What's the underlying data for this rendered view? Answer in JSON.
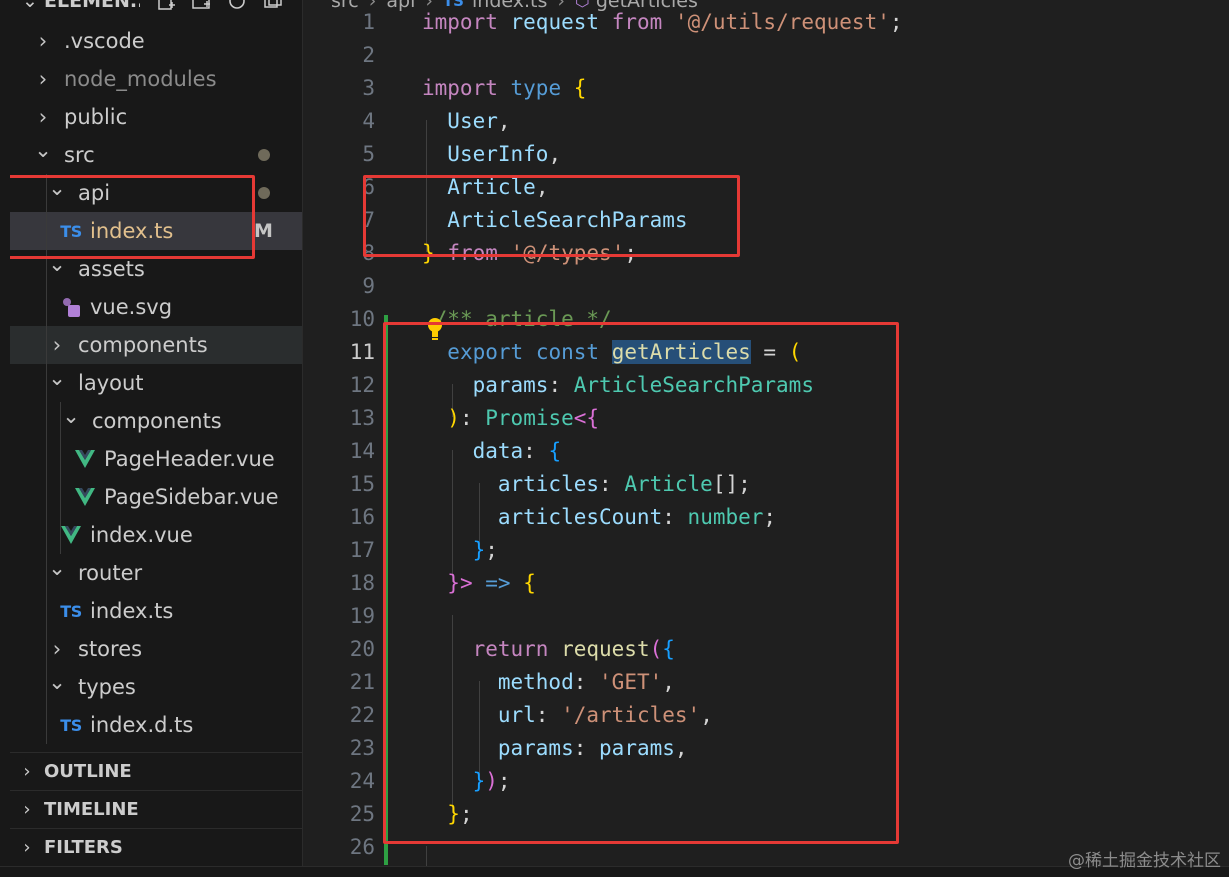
{
  "explorer": {
    "title": "ELEMEN...",
    "actions": [
      "new-file-icon",
      "new-folder-icon",
      "refresh-icon",
      "collapse-all-icon"
    ]
  },
  "tree": [
    {
      "label": ".vscode",
      "kind": "folder",
      "expanded": false,
      "depth": 0
    },
    {
      "label": "node_modules",
      "kind": "folder",
      "expanded": false,
      "depth": 0,
      "dim": true
    },
    {
      "label": "public",
      "kind": "folder",
      "expanded": false,
      "depth": 0
    },
    {
      "label": "src",
      "kind": "folder",
      "expanded": true,
      "depth": 0,
      "dot": true
    },
    {
      "label": "api",
      "kind": "folder",
      "expanded": true,
      "depth": 1,
      "dot": true
    },
    {
      "label": "index.ts",
      "kind": "ts",
      "depth": 2,
      "git": "M",
      "selected": true
    },
    {
      "label": "assets",
      "kind": "folder",
      "expanded": true,
      "depth": 1
    },
    {
      "label": "vue.svg",
      "kind": "svg",
      "depth": 2
    },
    {
      "label": "components",
      "kind": "folder",
      "expanded": false,
      "depth": 1,
      "hovered": true
    },
    {
      "label": "layout",
      "kind": "folder",
      "expanded": true,
      "depth": 1
    },
    {
      "label": "components",
      "kind": "folder",
      "expanded": true,
      "depth": 2
    },
    {
      "label": "PageHeader.vue",
      "kind": "vue",
      "depth": 3
    },
    {
      "label": "PageSidebar.vue",
      "kind": "vue",
      "depth": 3
    },
    {
      "label": "index.vue",
      "kind": "vue",
      "depth": 2
    },
    {
      "label": "router",
      "kind": "folder",
      "expanded": true,
      "depth": 1
    },
    {
      "label": "index.ts",
      "kind": "ts",
      "depth": 2
    },
    {
      "label": "stores",
      "kind": "folder",
      "expanded": false,
      "depth": 1
    },
    {
      "label": "types",
      "kind": "folder",
      "expanded": true,
      "depth": 1
    },
    {
      "label": "index.d.ts",
      "kind": "ts",
      "depth": 2
    }
  ],
  "git_badge": "M",
  "ts_badge": "TS",
  "sections": [
    "OUTLINE",
    "TIMELINE",
    "FILTERS"
  ],
  "breadcrumb": [
    "src",
    "api",
    "index.ts",
    "getArticles"
  ],
  "active_line": 11,
  "code_lines": [
    {
      "n": "1",
      "tokens": [
        [
          "kw",
          "import"
        ],
        [
          "",
          " "
        ],
        [
          "prop",
          "request"
        ],
        [
          "",
          " "
        ],
        [
          "kw",
          "from"
        ],
        [
          "",
          " "
        ],
        [
          "str",
          "'@/utils/request'"
        ],
        [
          "punc",
          ";"
        ]
      ]
    },
    {
      "n": "2",
      "tokens": []
    },
    {
      "n": "3",
      "tokens": [
        [
          "kw",
          "import"
        ],
        [
          "",
          " "
        ],
        [
          "kw2",
          "type"
        ],
        [
          "",
          " "
        ],
        [
          "b1",
          "{"
        ]
      ]
    },
    {
      "n": "4",
      "tokens": [
        [
          "",
          "  "
        ],
        [
          "prop",
          "User"
        ],
        [
          "punc",
          ","
        ]
      ]
    },
    {
      "n": "5",
      "tokens": [
        [
          "",
          "  "
        ],
        [
          "prop",
          "UserInfo"
        ],
        [
          "punc",
          ","
        ]
      ]
    },
    {
      "n": "6",
      "tokens": [
        [
          "",
          "  "
        ],
        [
          "prop",
          "Article"
        ],
        [
          "punc",
          ","
        ]
      ]
    },
    {
      "n": "7",
      "tokens": [
        [
          "",
          "  "
        ],
        [
          "prop",
          "ArticleSearchParams"
        ]
      ]
    },
    {
      "n": "8",
      "tokens": [
        [
          "b1",
          "}"
        ],
        [
          "",
          " "
        ],
        [
          "kw",
          "from"
        ],
        [
          "",
          " "
        ],
        [
          "str",
          "'@/types'"
        ],
        [
          "punc",
          ";"
        ]
      ]
    },
    {
      "n": "9",
      "tokens": []
    },
    {
      "n": "10",
      "tokens": [
        [
          "",
          " "
        ],
        [
          "cmt",
          "/** article */"
        ]
      ]
    },
    {
      "n": "11",
      "tokens": [
        [
          "",
          "  "
        ],
        [
          "kw2",
          "export"
        ],
        [
          "",
          " "
        ],
        [
          "kw2",
          "const"
        ],
        [
          "",
          " "
        ],
        [
          "fnhl",
          "getArticles"
        ],
        [
          "",
          " "
        ],
        [
          "punc",
          "="
        ],
        [
          "",
          " "
        ],
        [
          "b1",
          "("
        ]
      ]
    },
    {
      "n": "12",
      "tokens": [
        [
          "",
          "    "
        ],
        [
          "prop",
          "params"
        ],
        [
          "punc",
          ":"
        ],
        [
          "",
          " "
        ],
        [
          "type",
          "ArticleSearchParams"
        ]
      ]
    },
    {
      "n": "13",
      "tokens": [
        [
          "",
          "  "
        ],
        [
          "b1",
          ")"
        ],
        [
          "punc",
          ":"
        ],
        [
          "",
          " "
        ],
        [
          "type",
          "Promise"
        ],
        [
          "b2",
          "<{"
        ]
      ]
    },
    {
      "n": "14",
      "tokens": [
        [
          "",
          "    "
        ],
        [
          "prop",
          "data"
        ],
        [
          "punc",
          ":"
        ],
        [
          "",
          " "
        ],
        [
          "b3",
          "{"
        ]
      ]
    },
    {
      "n": "15",
      "tokens": [
        [
          "",
          "      "
        ],
        [
          "prop",
          "articles"
        ],
        [
          "punc",
          ":"
        ],
        [
          "",
          " "
        ],
        [
          "type",
          "Article"
        ],
        [
          "punc",
          "[];"
        ]
      ]
    },
    {
      "n": "16",
      "tokens": [
        [
          "",
          "      "
        ],
        [
          "prop",
          "articlesCount"
        ],
        [
          "punc",
          ":"
        ],
        [
          "",
          " "
        ],
        [
          "type",
          "number"
        ],
        [
          "punc",
          ";"
        ]
      ]
    },
    {
      "n": "17",
      "tokens": [
        [
          "",
          "    "
        ],
        [
          "b3",
          "}"
        ],
        [
          "punc",
          ";"
        ]
      ]
    },
    {
      "n": "18",
      "tokens": [
        [
          "",
          "  "
        ],
        [
          "b2",
          "}>"
        ],
        [
          "",
          " "
        ],
        [
          "kw2",
          "=>"
        ],
        [
          "",
          " "
        ],
        [
          "b1",
          "{"
        ]
      ]
    },
    {
      "n": "19",
      "tokens": []
    },
    {
      "n": "20",
      "tokens": [
        [
          "",
          "    "
        ],
        [
          "kw",
          "return"
        ],
        [
          "",
          " "
        ],
        [
          "fn",
          "request"
        ],
        [
          "b2",
          "("
        ],
        [
          "b3",
          "{"
        ]
      ]
    },
    {
      "n": "21",
      "tokens": [
        [
          "",
          "      "
        ],
        [
          "prop",
          "method"
        ],
        [
          "punc",
          ":"
        ],
        [
          "",
          " "
        ],
        [
          "str",
          "'GET'"
        ],
        [
          "punc",
          ","
        ]
      ]
    },
    {
      "n": "22",
      "tokens": [
        [
          "",
          "      "
        ],
        [
          "prop",
          "url"
        ],
        [
          "punc",
          ":"
        ],
        [
          "",
          " "
        ],
        [
          "str",
          "'/articles'"
        ],
        [
          "punc",
          ","
        ]
      ]
    },
    {
      "n": "23",
      "tokens": [
        [
          "",
          "      "
        ],
        [
          "prop",
          "params"
        ],
        [
          "punc",
          ":"
        ],
        [
          "",
          " "
        ],
        [
          "prop",
          "params"
        ],
        [
          "punc",
          ","
        ]
      ]
    },
    {
      "n": "24",
      "tokens": [
        [
          "",
          "    "
        ],
        [
          "b3",
          "}"
        ],
        [
          "b2",
          ")"
        ],
        [
          "punc",
          ";"
        ]
      ]
    },
    {
      "n": "25",
      "tokens": [
        [
          "",
          "  "
        ],
        [
          "b1",
          "}"
        ],
        [
          "punc",
          ";"
        ]
      ]
    },
    {
      "n": "26",
      "tokens": []
    }
  ],
  "watermark": "@稀土掘金技术社区",
  "colors": {
    "callout": "#e53935",
    "git_added": "#2ea043",
    "ts_icon": "#3b8eea",
    "vue_icon": "#41b883"
  }
}
